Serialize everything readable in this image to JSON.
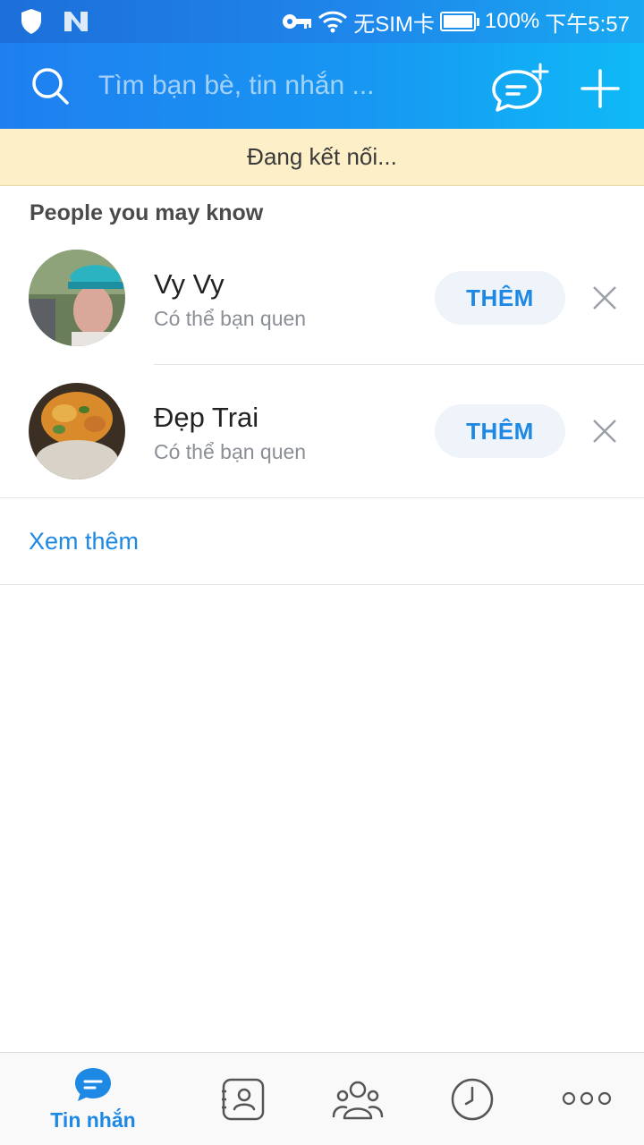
{
  "status_bar": {
    "left_icons": [
      "shield-icon",
      "n-logo-icon"
    ],
    "right_icons": [
      "key-icon",
      "wifi-icon",
      "battery-icon"
    ],
    "carrier": "无SIM卡",
    "battery": "100%",
    "time": "下午5:57"
  },
  "header": {
    "search_placeholder": "Tìm bạn bè, tin nhắn ...",
    "icons": [
      "search-icon",
      "new-chat-icon",
      "plus-icon"
    ]
  },
  "banner": {
    "text": "Đang kết nối..."
  },
  "suggestions": {
    "title": "People you may know",
    "items": [
      {
        "name": "Vy Vy",
        "subtitle": "Có thể bạn quen",
        "button": "THÊM"
      },
      {
        "name": "Đẹp Trai",
        "subtitle": "Có thể bạn quen",
        "button": "THÊM"
      }
    ],
    "see_more": "Xem thêm"
  },
  "bottom_nav": {
    "items": [
      {
        "label": "Tin nhắn",
        "icon": "chat-bubble-icon",
        "active": true
      },
      {
        "label": "",
        "icon": "contacts-icon",
        "active": false
      },
      {
        "label": "",
        "icon": "groups-icon",
        "active": false
      },
      {
        "label": "",
        "icon": "clock-icon",
        "active": false
      },
      {
        "label": "",
        "icon": "more-icon",
        "active": false
      }
    ]
  },
  "colors": {
    "accent": "#1e88e5",
    "banner_bg": "#fdefc7",
    "header_start": "#1f7ff0",
    "header_end": "#0fbaf7"
  }
}
